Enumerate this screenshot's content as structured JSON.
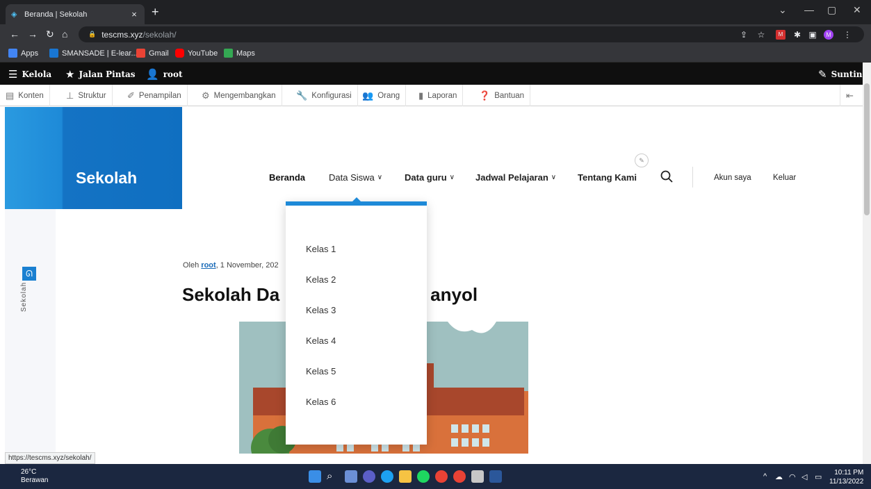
{
  "browser": {
    "tab_title": "Beranda | Sekolah",
    "tab_close": "×",
    "new_tab": "+",
    "url_host": "tescms.xyz",
    "url_path": "/sekolah/",
    "profile_initial": "M",
    "bookmarks": [
      {
        "label": "Apps",
        "color": "#4285f4"
      },
      {
        "label": "SMANSADE | E-lear...",
        "color": "#1976d2"
      },
      {
        "label": "Gmail",
        "color": "#ea4335"
      },
      {
        "label": "YouTube",
        "color": "#ff0000"
      },
      {
        "label": "Maps",
        "color": "#34a853"
      }
    ],
    "status_url": "https://tescms.xyz/sekolah/"
  },
  "admin_toolbar": {
    "manage": "Kelola",
    "shortcuts": "Jalan Pintas",
    "user": "root",
    "edit": "Sunting"
  },
  "admin_tray": {
    "items": [
      "Konten",
      "Struktur",
      "Penampilan",
      "Mengembangkan",
      "Konfigurasi",
      "Orang",
      "Laporan",
      "Bantuan"
    ]
  },
  "site": {
    "name": "Sekolah",
    "side_label": "Sekolah",
    "nav": [
      {
        "label": "Beranda",
        "has_children": false
      },
      {
        "label": "Data Siswa",
        "has_children": true
      },
      {
        "label": "Data guru",
        "has_children": true
      },
      {
        "label": "Jadwal Pelajaran",
        "has_children": true
      },
      {
        "label": "Tentang Kami",
        "has_children": false
      }
    ],
    "account": "Akun saya",
    "logout": "Keluar",
    "dropdown": [
      "Kelas 1",
      "Kelas 2",
      "Kelas 3",
      "Kelas 4",
      "Kelas 5",
      "Kelas 6"
    ],
    "article": {
      "meta_prefix": "Oleh ",
      "author": "root",
      "date_partial": ", 1 November, 202",
      "title_left": "Sekolah Da",
      "title_right": "anyol"
    },
    "accent_color": "#1e8ad8"
  },
  "taskbar": {
    "temp": "26°C",
    "weather": "Berawan",
    "time": "10:11 PM",
    "date": "11/13/2022"
  }
}
